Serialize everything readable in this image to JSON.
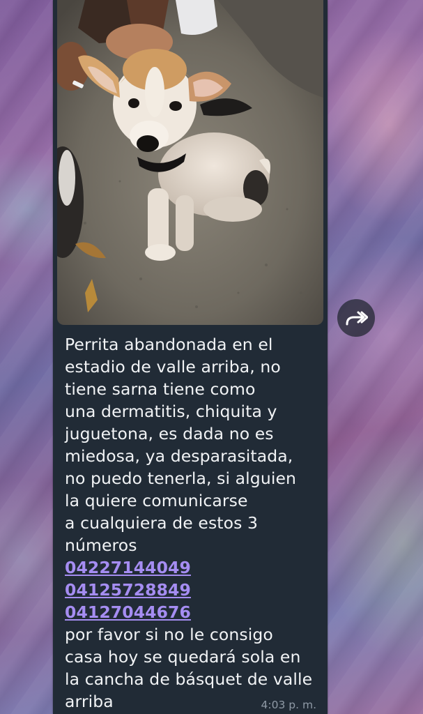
{
  "message": {
    "lines_before_phones": [
      "Perrita abandonada en el",
      "estadio de valle arriba, no",
      "tiene sarna tiene como",
      "una dermatitis, chiquita y",
      "juguetona, es dada no es",
      "miedosa, ya desparasitada,",
      "no puedo tenerla, si alguien",
      "la quiere comunicarse",
      "a cualquiera de estos 3",
      "números"
    ],
    "phones": [
      "04227144049",
      "04125728849",
      "04127044676"
    ],
    "lines_after_phones": [
      "por favor si no le consigo",
      "casa hoy se quedará sola en",
      "la cancha de básquet de valle",
      "arriba"
    ],
    "time": "4:03 p. m."
  },
  "photo": {
    "icon": "puppy-photo"
  },
  "forward": {
    "icon": "forward-arrow-icon"
  },
  "colors": {
    "bubble": "#212b36",
    "text": "#f1f3f5",
    "link": "#a58df2",
    "timestamp": "#8f9aa6"
  }
}
